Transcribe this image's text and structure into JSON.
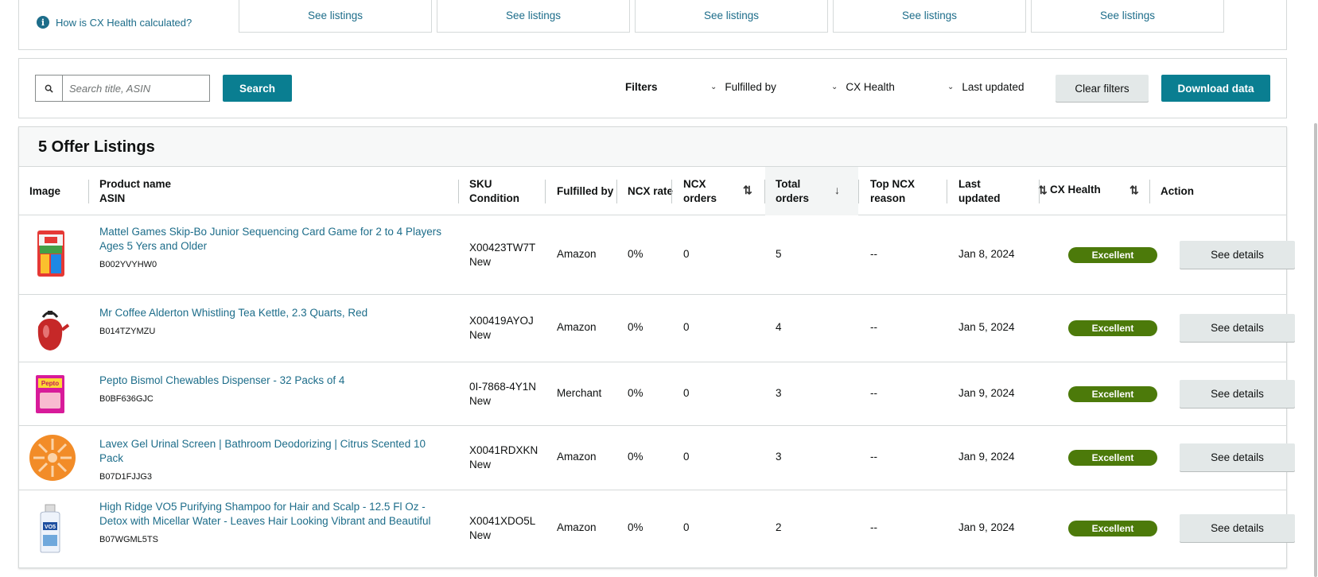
{
  "top": {
    "info_link": "How is CX Health calculated?",
    "see_listings": [
      "See listings",
      "See listings",
      "See listings",
      "See listings",
      "See listings"
    ]
  },
  "filter_bar": {
    "search_placeholder": "Search title, ASIN",
    "search_button": "Search",
    "filters_label": "Filters",
    "dropdowns": [
      "Fulfilled by",
      "CX Health",
      "Last updated"
    ],
    "clear_button": "Clear filters",
    "download_button": "Download data"
  },
  "table": {
    "title": "5 Offer Listings",
    "headers": {
      "image": "Image",
      "product_name": "Product name",
      "asin": "ASIN",
      "sku": "SKU",
      "condition": "Condition",
      "fulfilled_by": "Fulfilled by",
      "ncx_rate": "NCX rate",
      "ncx_orders_1": "NCX",
      "ncx_orders_2": "orders",
      "total_orders_1": "Total",
      "total_orders_2": "orders",
      "top_ncx_1": "Top NCX",
      "top_ncx_2": "reason",
      "last_updated_1": "Last",
      "last_updated_2": "updated",
      "cx_health": "CX Health",
      "action": "Action"
    },
    "rows": [
      {
        "product": "Mattel Games Skip-Bo Junior Sequencing Card Game for 2 to 4 Players Ages 5 Yers and Older",
        "asin": "B002YVYHW0",
        "sku": "X00423TW7T",
        "condition": "New",
        "fulfilled_by": "Amazon",
        "ncx_rate": "0%",
        "ncx_orders": "0",
        "total_orders": "5",
        "top_ncx": "--",
        "last_updated": "Jan 8, 2024",
        "cx_health": "Excellent",
        "action": "See details",
        "image_icon": "card-game-box"
      },
      {
        "product": "Mr Coffee Alderton Whistling Tea Kettle, 2.3 Quarts, Red",
        "asin": "B014TZYMZU",
        "sku": "X00419AYOJ",
        "condition": "New",
        "fulfilled_by": "Amazon",
        "ncx_rate": "0%",
        "ncx_orders": "0",
        "total_orders": "4",
        "top_ncx": "--",
        "last_updated": "Jan 5, 2024",
        "cx_health": "Excellent",
        "action": "See details",
        "image_icon": "red-kettle"
      },
      {
        "product": "Pepto Bismol Chewables Dispenser - 32 Packs of 4",
        "asin": "B0BF636GJC",
        "sku": "0I-7868-4Y1N",
        "condition": "New",
        "fulfilled_by": "Merchant",
        "ncx_rate": "0%",
        "ncx_orders": "0",
        "total_orders": "3",
        "top_ncx": "--",
        "last_updated": "Jan 9, 2024",
        "cx_health": "Excellent",
        "action": "See details",
        "image_icon": "pink-box"
      },
      {
        "product": "Lavex Gel Urinal Screen | Bathroom Deodorizing | Citrus Scented 10 Pack",
        "asin": "B07D1FJJG3",
        "sku": "X0041RDXKN",
        "condition": "New",
        "fulfilled_by": "Amazon",
        "ncx_rate": "0%",
        "ncx_orders": "0",
        "total_orders": "3",
        "top_ncx": "--",
        "last_updated": "Jan 9, 2024",
        "cx_health": "Excellent",
        "action": "See details",
        "image_icon": "orange-screen"
      },
      {
        "product": "High Ridge VO5 Purifying Shampoo for Hair and Scalp - 12.5 Fl Oz - Detox with Micellar Water - Leaves Hair Looking Vibrant and Beautiful",
        "asin": "B07WGML5TS",
        "sku": "X0041XDO5L",
        "condition": "New",
        "fulfilled_by": "Amazon",
        "ncx_rate": "0%",
        "ncx_orders": "0",
        "total_orders": "2",
        "top_ncx": "--",
        "last_updated": "Jan 9, 2024",
        "cx_health": "Excellent",
        "action": "See details",
        "image_icon": "shampoo-bottle"
      }
    ]
  },
  "colors": {
    "link": "#1d6d8a",
    "primary_button": "#0a7e91",
    "badge_excellent": "#4c7a0a",
    "secondary_button": "#e3e8e8"
  }
}
